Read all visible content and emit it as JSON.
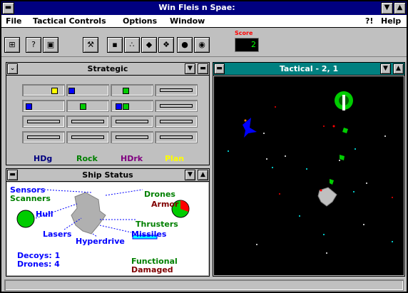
{
  "window": {
    "title": "Win Fleis n Spae:"
  },
  "menu": {
    "file": "File",
    "tactical": "Tactical Controls",
    "options": "Options",
    "window": "Window",
    "help_q": "?!",
    "help": "Help"
  },
  "toolbar": {
    "score_label": "Score",
    "score_value": "2"
  },
  "strategic": {
    "title": "Strategic",
    "legend": [
      {
        "label": "HDg",
        "color": "#000080"
      },
      {
        "label": "Rock",
        "color": "#008000"
      },
      {
        "label": "HDrk",
        "color": "#800080"
      },
      {
        "label": "Plan",
        "color": "#ffff00"
      }
    ]
  },
  "tactical": {
    "title": "Tactical - 2, 1"
  },
  "ship_status": {
    "title": "Ship Status",
    "sensors": "Sensors",
    "scanners": "Scanners",
    "hull": "Hull",
    "lasers": "Lasers",
    "hyperdrive": "Hyperdrive",
    "drones": "Drones",
    "armor": "Armor",
    "thrusters": "Thrusters",
    "missiles": "Missiles",
    "decoys": "Decoys: 1",
    "drones_count": "Drones: 4",
    "functional": "Functional",
    "damaged": "Damaged"
  }
}
